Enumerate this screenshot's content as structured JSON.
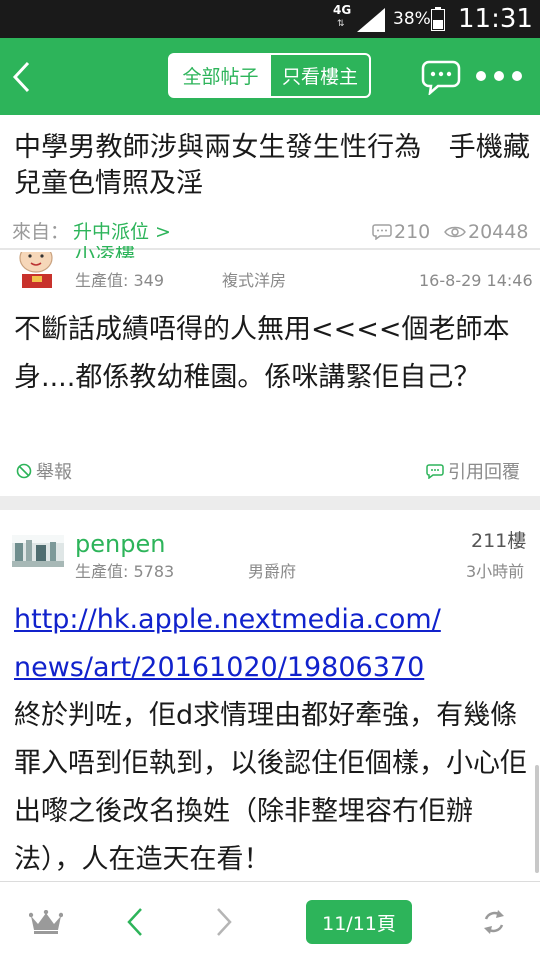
{
  "status_bar": {
    "network": "4G",
    "battery": "38%",
    "time": "11:31"
  },
  "header": {
    "tab_all": "全部帖子",
    "tab_op_only": "只看樓主"
  },
  "thread": {
    "title": "中學男教師涉與兩女生發生性行為　手機藏兒童色情照及淫",
    "source_label": "來自：",
    "source_name": "升中派位 >",
    "reply_count": "210",
    "view_count": "20448"
  },
  "posts": [
    {
      "username": "小凌樓",
      "production_label": "生產值: 349",
      "rank": "複式洋房",
      "date": "16-8-29 14:46",
      "body": "不斷話成績唔得的人無用<<<<個老師本身....都係教幼稚園。係咪講緊佢自己？",
      "report_label": "舉報",
      "quote_label": "引用回覆"
    },
    {
      "username": "penpen",
      "floor": "211樓",
      "production_label": "生產值: 5783",
      "rank": "男爵府",
      "date": "3小時前",
      "link_line1": "http://hk.apple.nextmedia.com/",
      "link_line2": "news/art/20161020/19806370",
      "body": "終於判咗，佢d求情理由都好牽強，有幾條罪入唔到佢執到，以後認住佢個樣，小心佢出嚟之後改名換姓（除非整埋容冇佢辦法），人在造天在看！"
    }
  ],
  "bottom_bar": {
    "page_indicator": "11/11頁"
  },
  "colors": {
    "brand_green": "#2db45a",
    "status_bar": "#1a1a1a",
    "link_blue": "#1122cc"
  },
  "icons": [
    "back-icon",
    "chat-icon",
    "more-icon",
    "reply-count-icon",
    "view-count-icon",
    "report-icon",
    "quote-icon",
    "crown-icon",
    "prev-page-icon",
    "next-page-icon",
    "refresh-icon"
  ]
}
